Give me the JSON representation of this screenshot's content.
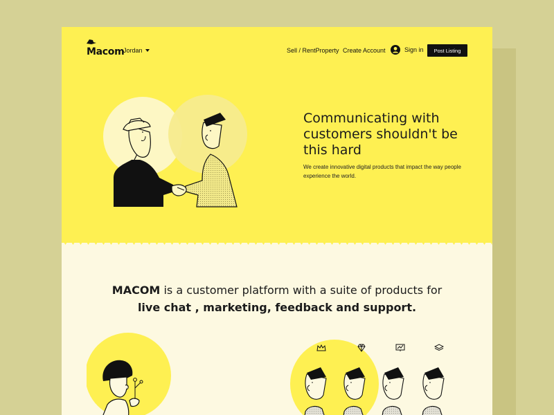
{
  "brand": {
    "name": "Macom"
  },
  "nav": {
    "location": "Jordan",
    "links": [
      "Sell / RentProperty",
      "Create Account"
    ],
    "signin": "Sign in",
    "post_listing": "Post Listing"
  },
  "hero": {
    "title": "Communicating with customers shouldn't be this hard",
    "subtitle": "We create innovative digital products that impact the way people experience the world."
  },
  "about": {
    "brand_word": "MACOM",
    "line1_rest": " is a customer platform with a suite of products for",
    "line2": "live chat , marketing, feedback and support."
  },
  "feature_icons": [
    "crown-icon",
    "diamond-icon",
    "chart-icon",
    "layers-icon"
  ],
  "colors": {
    "background": "#d5d195",
    "hero_yellow": "#fef052",
    "cream": "#fdf9e1",
    "ink": "#111111"
  }
}
